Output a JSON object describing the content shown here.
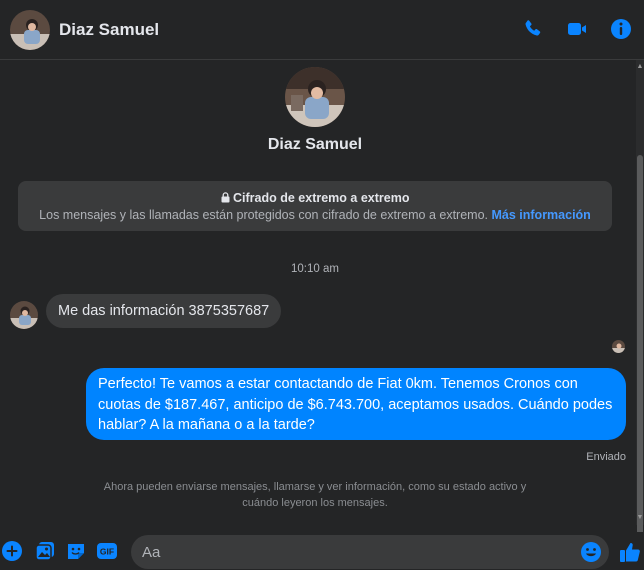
{
  "header": {
    "contact_name": "Diaz Samuel",
    "icons": [
      "phone-icon",
      "video-camera-icon",
      "info-icon"
    ]
  },
  "profile": {
    "name": "Diaz Samuel"
  },
  "encryption": {
    "title": "Cifrado de extremo a extremo",
    "text": "Los mensajes y las llamadas están protegidos con cifrado de extremo a extremo.",
    "link": "Más información"
  },
  "conversation": {
    "timestamp": "10:10 am",
    "incoming": "Me das información 3875357687",
    "outgoing": "Perfecto! Te vamos a estar contactando de Fiat 0km. Tenemos Cronos con cuotas de $187.467, anticipo de $6.743.700, aceptamos usados. Cuándo podes hablar? A la mañana o a la tarde?",
    "status": "Enviado",
    "notice": "Ahora pueden enviarse mensajes, llamarse y ver información, como su estado activo y cuándo leyeron los mensajes."
  },
  "composer": {
    "placeholder": "Aa",
    "gif_label": "GIF",
    "icons": [
      "plus-icon",
      "image-icon",
      "sticker-icon",
      "gif-icon",
      "emoji-icon",
      "like-icon"
    ]
  },
  "colors": {
    "accent": "#0084ff",
    "background": "#242526",
    "bubble_in": "#3a3b3c",
    "link": "#4599ff"
  }
}
